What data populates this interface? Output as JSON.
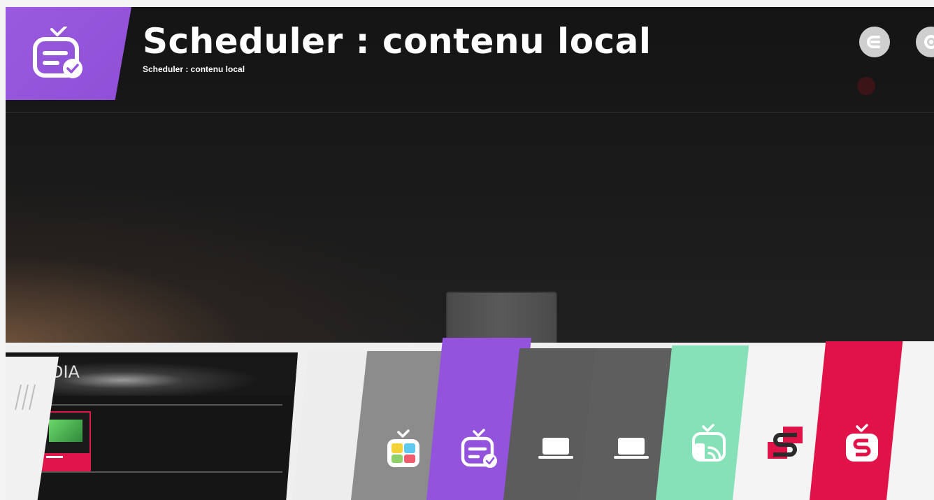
{
  "header": {
    "title": "Scheduler : contenu local",
    "subtitle": "Scheduler : contenu local",
    "accent_color": "#9353dc",
    "tile_icon": "tv-checklist-icon",
    "buttons": [
      {
        "icon": "back-icon"
      },
      {
        "icon": "gear-icon"
      }
    ]
  },
  "preview_panel": {
    "banner_text": "DIA",
    "handle_icon": "drag-handle-icon"
  },
  "launcher": {
    "tiles": [
      {
        "name": "live-tv",
        "icon": "colorful-tv-icon",
        "color": "#8c8c8c"
      },
      {
        "name": "scheduler-local-content",
        "icon": "tv-checklist-icon",
        "color": "#9353dc",
        "selected": true
      },
      {
        "name": "input-1",
        "icon": "laptop-icon",
        "color": "#5c5c5c"
      },
      {
        "name": "input-2",
        "icon": "laptop-icon",
        "color": "#5e5e5e"
      },
      {
        "name": "screen-share",
        "icon": "screen-share-icon",
        "color": "#86e0b8"
      },
      {
        "name": "signage-app",
        "icon": "signage-s-icon",
        "color": "#f4f4f4"
      },
      {
        "name": "supersign-app",
        "icon": "tv-s-icon",
        "color": "#e01247"
      },
      {
        "name": "next",
        "icon": "",
        "color": "#f4f4f4"
      }
    ]
  }
}
